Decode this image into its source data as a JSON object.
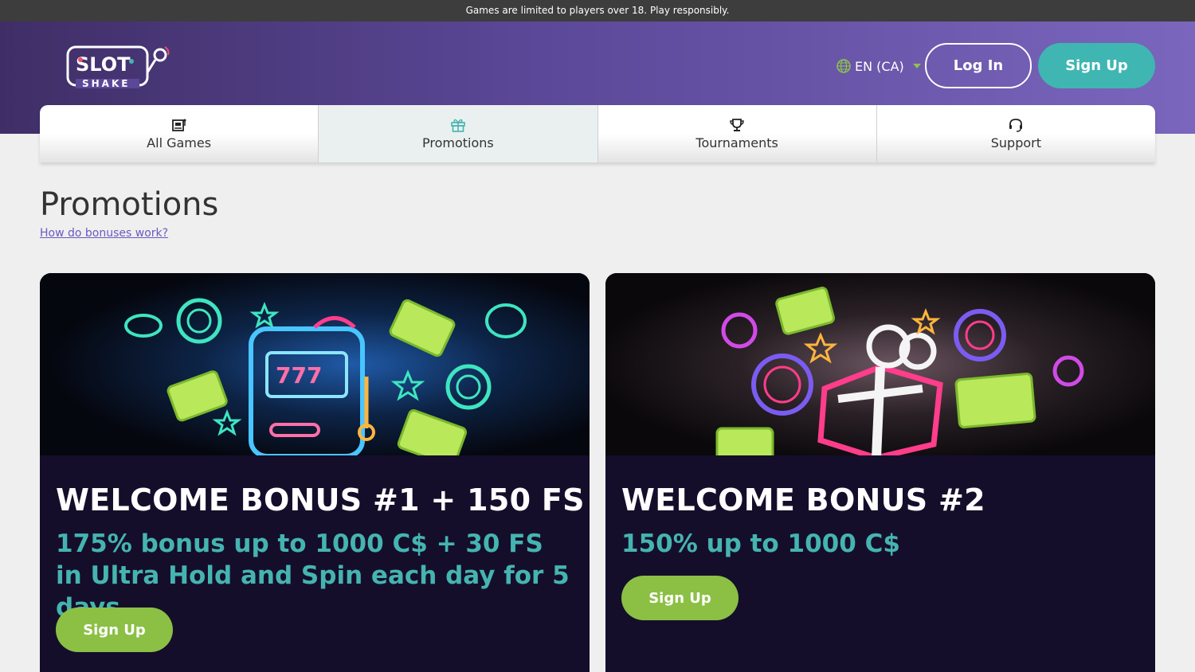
{
  "topbar": {
    "notice": "Games are limited to players over 18. Play responsibly."
  },
  "header": {
    "logo_text_top": "SLOT",
    "logo_text_bottom": "SHAKE",
    "language": "EN (CA)",
    "login_label": "Log In",
    "signup_label": "Sign Up"
  },
  "nav": {
    "items": [
      {
        "label": "All Games",
        "icon": "slot-machine-icon"
      },
      {
        "label": "Promotions",
        "icon": "gift-icon",
        "active": true
      },
      {
        "label": "Tournaments",
        "icon": "trophy-icon"
      },
      {
        "label": "Support",
        "icon": "headset-icon"
      }
    ]
  },
  "page": {
    "title": "Promotions",
    "help_link": "How do bonuses work?"
  },
  "promotions": [
    {
      "title": "WELCOME BONUS #1 + 150 FS",
      "subtitle": "175% bonus up to 1000 C$ + 30 FS in Ultra Hold and Spin each day for 5 days",
      "button": "Sign Up",
      "image": "neon-slot-machine"
    },
    {
      "title": "WELCOME BONUS #2",
      "subtitle": "150% up to 1000 C$",
      "button": "Sign Up",
      "image": "neon-gift-box"
    }
  ],
  "colors": {
    "accent_teal": "#3fb6b2",
    "accent_green": "#8bc044",
    "card_bg": "#150e2b",
    "link_purple": "#6a5ac0"
  }
}
